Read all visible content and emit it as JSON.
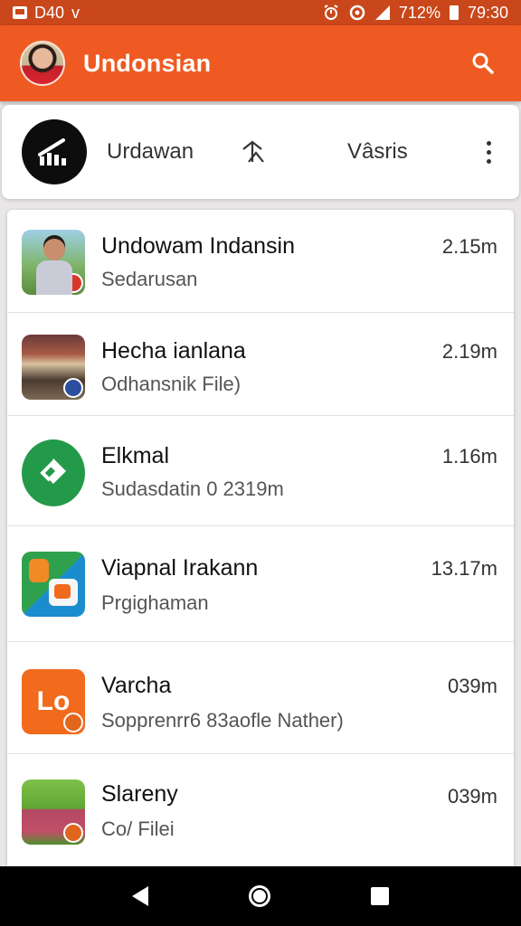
{
  "status_bar": {
    "time_left": "D40",
    "carrier_mark": "v",
    "battery_percent": "712%",
    "time_right": "79:30",
    "icons": [
      "message-icon",
      "alarm-icon",
      "wifi-icon",
      "signal-icon",
      "battery-icon"
    ]
  },
  "app_bar": {
    "title": "Undonsian",
    "avatar": "profile-avatar",
    "search_icon": "search-icon"
  },
  "toolbar": {
    "logo": "chart-logo-icon",
    "label_left": "Urdawan",
    "arrow_icon": "sort-arrow-icon",
    "label_right": "Vâsris",
    "more_icon": "more-vert-icon"
  },
  "list": {
    "items": [
      {
        "title": "Undowam Indansin",
        "subtitle": "Sedarusan",
        "size": "2.15m",
        "thumb": "person-photo"
      },
      {
        "title": "Hecha ianlana",
        "subtitle": "Odhansnik File)",
        "size": "2.19m",
        "thumb": "building-photo"
      },
      {
        "title": "Elkmal",
        "subtitle": "Sudasdatin 0 2319m",
        "size": "1.16m",
        "thumb": "green-logo"
      },
      {
        "title": "Viapnal Irakann",
        "subtitle": "Prgighaman",
        "size": "13.17m",
        "thumb": "colorful-app"
      },
      {
        "title": "Varcha",
        "subtitle": "Sopprenrr6 83aofle Nather)",
        "size": "039m",
        "thumb": "orange-lo-logo"
      },
      {
        "title": "Slareny",
        "subtitle": "Co/ Filei",
        "size": "039m",
        "thumb": "store-photo"
      }
    ]
  },
  "thumb_logo_text": {
    "t5": "Lo"
  },
  "nav_bar": {
    "icons": [
      "back-icon",
      "home-icon",
      "recents-icon"
    ]
  },
  "colors": {
    "status_bar": "#c9471a",
    "app_bar": "#ef5a22",
    "background": "#e8e6e6",
    "card": "#ffffff"
  }
}
